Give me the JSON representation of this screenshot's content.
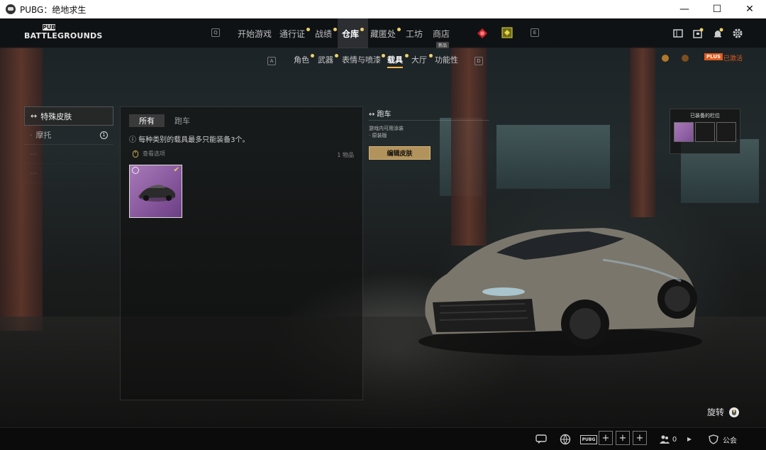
{
  "window": {
    "title": "PUBG：绝地求生",
    "min": "—",
    "max": "☐",
    "close": "✕"
  },
  "logo": {
    "small": "PUBG",
    "big": "BATTLEGROUNDS"
  },
  "nav": {
    "key_left": "Q",
    "items": [
      "开始游戏",
      "通行证",
      "战绩",
      "仓库",
      "藏匿处",
      "工坊",
      "商店"
    ],
    "new_tag": "新品",
    "key_right": "E"
  },
  "subnav": {
    "key_left": "A",
    "items": [
      "角色",
      "武器",
      "表情与喷漆",
      "载具",
      "大厅",
      "功能性"
    ],
    "key_right": "D",
    "activated": "已激活",
    "badge": "PLUS"
  },
  "sidebar": {
    "items": [
      {
        "label": "特殊皮肤",
        "badge": ""
      },
      {
        "label": "摩托",
        "badge": "1"
      },
      {
        "label": "···",
        "badge": ""
      },
      {
        "label": "···",
        "badge": ""
      }
    ]
  },
  "panel": {
    "tabs": [
      "所有",
      "跑车"
    ],
    "notice": "ⓘ 每种类别的载具最多只能装备3个。",
    "view_option": "查看选项",
    "count": "1 物品"
  },
  "info": {
    "title": "↔ 跑车",
    "desc_line1": "游戏内可用涂装",
    "desc_line2": "· 原装版",
    "edit_button": "编辑皮肤"
  },
  "equipped": {
    "title": "已装备的栏位"
  },
  "rotate": {
    "label": "旋转"
  },
  "bottom": {
    "pubg": "PUBG",
    "friends": "0",
    "clan": "公会"
  }
}
